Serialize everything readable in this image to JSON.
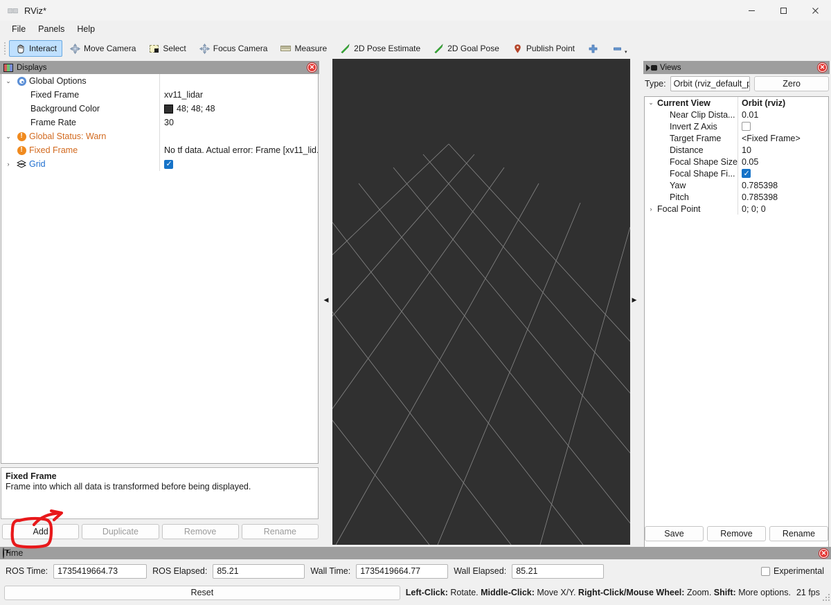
{
  "window": {
    "title": "RViz*",
    "app_icon": "rviz-logo-icon",
    "minimize": "–",
    "maximize": "▢",
    "close": "✕"
  },
  "menubar": {
    "items": [
      {
        "label": "File"
      },
      {
        "label": "Panels"
      },
      {
        "label": "Help"
      }
    ]
  },
  "toolbar": {
    "items": [
      {
        "label": "Interact",
        "icon": "hand-cursor-icon",
        "active": true
      },
      {
        "label": "Move Camera",
        "icon": "move-camera-icon",
        "active": false
      },
      {
        "label": "Select",
        "icon": "select-rectangle-icon",
        "active": false
      },
      {
        "label": "Focus Camera",
        "icon": "focus-camera-icon",
        "active": false
      },
      {
        "label": "Measure",
        "icon": "ruler-icon",
        "active": false
      },
      {
        "label": "2D Pose Estimate",
        "icon": "green-arrow-icon",
        "active": false
      },
      {
        "label": "2D Goal Pose",
        "icon": "green-arrow-icon",
        "active": false
      },
      {
        "label": "Publish Point",
        "icon": "map-pin-icon",
        "active": false
      }
    ],
    "plus_icon": "plus-icon",
    "minus_icon": "minus-icon",
    "overflow_caret": "▾"
  },
  "displays": {
    "header": {
      "title": "Displays",
      "icon": "displays-monitor-icon",
      "close": "✕"
    },
    "rows": [
      {
        "twisty": "⌄",
        "icon": "gear-icon",
        "label": "Global Options",
        "indent": 0,
        "style": "normal",
        "value_type": "none",
        "value": ""
      },
      {
        "twisty": "",
        "icon": "",
        "label": "Fixed Frame",
        "indent": 1,
        "style": "normal",
        "value_type": "text",
        "value": "xv11_lidar"
      },
      {
        "twisty": "",
        "icon": "",
        "label": "Background Color",
        "indent": 1,
        "style": "normal",
        "value_type": "color",
        "value": "48; 48; 48",
        "swatch": "#303030"
      },
      {
        "twisty": "",
        "icon": "",
        "label": "Frame Rate",
        "indent": 1,
        "style": "normal",
        "value_type": "text",
        "value": "30"
      },
      {
        "twisty": "⌄",
        "icon": "warning-icon",
        "label": "Global Status: Warn",
        "indent": 0,
        "style": "warn",
        "value_type": "none",
        "value": ""
      },
      {
        "twisty": "",
        "icon": "warning-icon",
        "label": "Fixed Frame",
        "indent": 1,
        "style": "warn",
        "value_type": "text",
        "value": "No tf data.  Actual error: Frame [xv11_lid..."
      },
      {
        "twisty": "›",
        "icon": "grid-icon",
        "label": "Grid",
        "indent": 0,
        "style": "link",
        "value_type": "checkbox",
        "value": "checked"
      }
    ],
    "description": {
      "title": "Fixed Frame",
      "text": "Frame into which all data is transformed before being displayed."
    },
    "buttons": [
      {
        "label": "Add",
        "enabled": true
      },
      {
        "label": "Duplicate",
        "enabled": false
      },
      {
        "label": "Remove",
        "enabled": false
      },
      {
        "label": "Rename",
        "enabled": false
      }
    ]
  },
  "viewport": {
    "background_color": "#303030",
    "grid_color": "#9b9b9b",
    "collapse_left_icon": "◀",
    "collapse_right_icon": "▶"
  },
  "views": {
    "header": {
      "title": "Views",
      "icon": "camera-icon",
      "close": "✕"
    },
    "type_label": "Type:",
    "type_value": "Orbit (rviz_default_plugins",
    "type_caret": "⌄",
    "zero_button": "Zero",
    "rows": [
      {
        "twisty": "⌄",
        "label": "Current View",
        "indent": 0,
        "bold": true,
        "value_type": "text",
        "value": "Orbit (rviz)"
      },
      {
        "twisty": "",
        "label": "Near Clip Dista...",
        "indent": 1,
        "bold": false,
        "value_type": "text",
        "value": "0.01"
      },
      {
        "twisty": "",
        "label": "Invert Z Axis",
        "indent": 1,
        "bold": false,
        "value_type": "checkbox",
        "value": "unchecked"
      },
      {
        "twisty": "",
        "label": "Target Frame",
        "indent": 1,
        "bold": false,
        "value_type": "text",
        "value": "<Fixed Frame>"
      },
      {
        "twisty": "",
        "label": "Distance",
        "indent": 1,
        "bold": false,
        "value_type": "text",
        "value": "10"
      },
      {
        "twisty": "",
        "label": "Focal Shape Size",
        "indent": 1,
        "bold": false,
        "value_type": "text",
        "value": "0.05"
      },
      {
        "twisty": "",
        "label": "Focal Shape Fi...",
        "indent": 1,
        "bold": false,
        "value_type": "checkbox",
        "value": "checked"
      },
      {
        "twisty": "",
        "label": "Yaw",
        "indent": 1,
        "bold": false,
        "value_type": "text",
        "value": "0.785398"
      },
      {
        "twisty": "",
        "label": "Pitch",
        "indent": 1,
        "bold": false,
        "value_type": "text",
        "value": "0.785398"
      },
      {
        "twisty": "›",
        "label": "Focal Point",
        "indent": 1,
        "bold": false,
        "value_type": "text",
        "value": "0; 0; 0"
      }
    ],
    "buttons": [
      {
        "label": "Save"
      },
      {
        "label": "Remove"
      },
      {
        "label": "Rename"
      }
    ]
  },
  "time": {
    "header": {
      "title": "Time",
      "icon": "clock-icon",
      "close": "✕"
    },
    "fields": [
      {
        "label": "ROS Time:",
        "value": "1735419664.73"
      },
      {
        "label": "ROS Elapsed:",
        "value": "85.21"
      },
      {
        "label": "Wall Time:",
        "value": "1735419664.77"
      },
      {
        "label": "Wall Elapsed:",
        "value": "85.21"
      }
    ],
    "experimental": {
      "label": "Experimental",
      "checked": false
    }
  },
  "statusbar": {
    "reset_button": "Reset",
    "hint_parts": [
      {
        "text": "Left-Click:",
        "bold": true
      },
      {
        "text": " Rotate. ",
        "bold": false
      },
      {
        "text": "Middle-Click:",
        "bold": true
      },
      {
        "text": " Move X/Y. ",
        "bold": false
      },
      {
        "text": "Right-Click/Mouse Wheel:",
        "bold": true
      },
      {
        "text": " Zoom. ",
        "bold": false
      },
      {
        "text": "Shift:",
        "bold": true
      },
      {
        "text": " More options.",
        "bold": false
      }
    ],
    "fps": "21 fps"
  },
  "annotation": {
    "color": "#e8191b",
    "shape": "hand-drawn-box-with-arrow",
    "target": "Add button"
  }
}
